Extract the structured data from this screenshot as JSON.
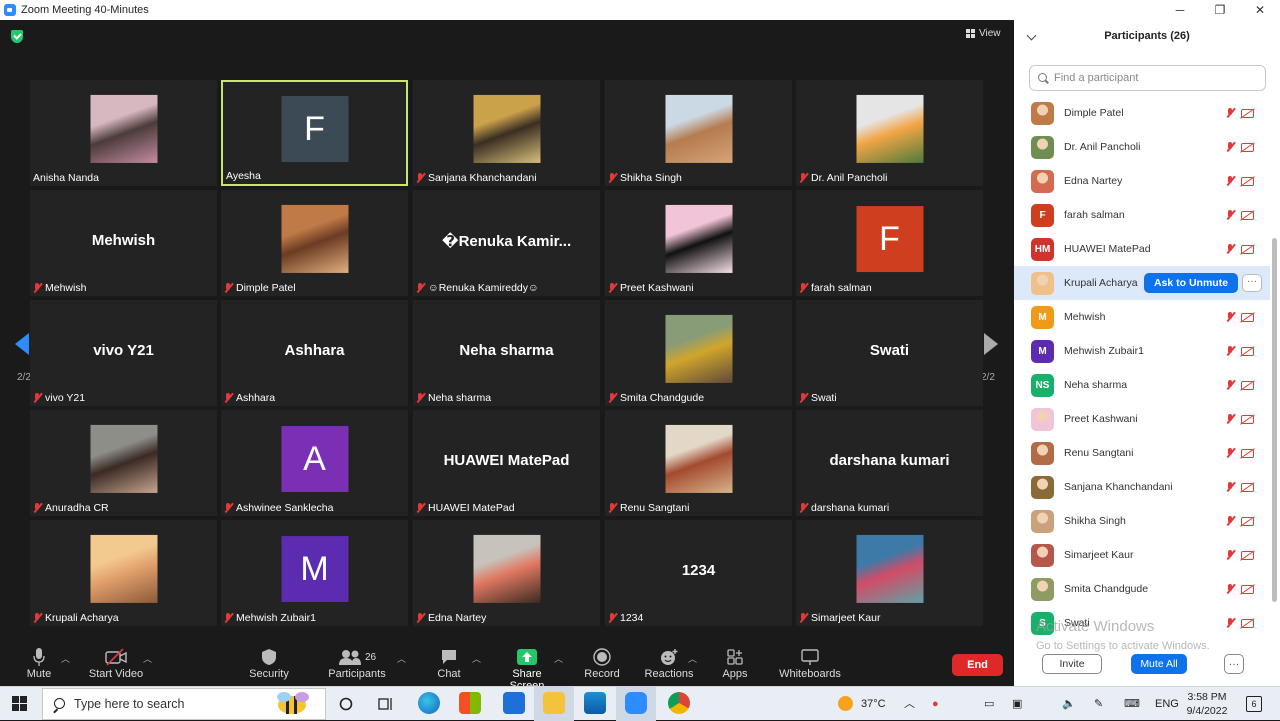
{
  "window": {
    "title": "Zoom Meeting 40-Minutes",
    "controls": [
      "─",
      "❐",
      "✕"
    ]
  },
  "view_label": "View",
  "pager": {
    "left": "2/2",
    "right": "2/2"
  },
  "tiles": [
    {
      "name": "Anisha Nanda",
      "kind": "photo",
      "colors": [
        "#d7b7c0",
        "#4b3c3a",
        "#c58ca2"
      ],
      "muted": false
    },
    {
      "name": "Ayesha",
      "kind": "letter",
      "letter": "F",
      "bg": "#3c4a55",
      "muted": false,
      "active": true
    },
    {
      "name": "Sanjana Khanchandani",
      "kind": "photo",
      "colors": [
        "#caa24a",
        "#3a2e22",
        "#d7c07a"
      ],
      "muted": true
    },
    {
      "name": "Shikha Singh",
      "kind": "photo",
      "colors": [
        "#cbd9e5",
        "#b47c4f",
        "#d6a377"
      ],
      "muted": true
    },
    {
      "name": "Dr. Anil Pancholi",
      "kind": "photo",
      "colors": [
        "#e5e5e5",
        "#f2a546",
        "#4e7a3c"
      ],
      "muted": true
    },
    {
      "name": "Mehwish",
      "kind": "text",
      "label": "Mehwish",
      "muted": true
    },
    {
      "name": "Dimple Patel",
      "kind": "photo",
      "colors": [
        "#c07a47",
        "#6b3b24",
        "#e2b07e"
      ],
      "muted": true
    },
    {
      "name": "☺Renuka Kamireddy☺",
      "kind": "text",
      "label": "�Renuka  Kamir...",
      "muted": true
    },
    {
      "name": "Preet Kashwani",
      "kind": "photo",
      "colors": [
        "#f1c4d8",
        "#111111",
        "#f8dfe9"
      ],
      "muted": true
    },
    {
      "name": "farah salman",
      "kind": "letter",
      "letter": "F",
      "bg": "#cf3e1f",
      "muted": true
    },
    {
      "name": "vivo Y21",
      "kind": "text",
      "label": "vivo Y21",
      "muted": true
    },
    {
      "name": "Ashhara",
      "kind": "text",
      "label": "Ashhara",
      "muted": true
    },
    {
      "name": "Neha sharma",
      "kind": "text",
      "label": "Neha sharma",
      "muted": true
    },
    {
      "name": "Smita Chandgude",
      "kind": "photo",
      "colors": [
        "#889c78",
        "#d1a52b",
        "#5f4a3a"
      ],
      "muted": true
    },
    {
      "name": "Swati",
      "kind": "text",
      "label": "Swati",
      "muted": true
    },
    {
      "name": "Anuradha CR",
      "kind": "photo",
      "colors": [
        "#8e8e88",
        "#3a2a24",
        "#c7a58f"
      ],
      "muted": true
    },
    {
      "name": "Ashwinee Sanklecha",
      "kind": "letter",
      "letter": "A",
      "bg": "#7b2fb5",
      "muted": true
    },
    {
      "name": "HUAWEI MatePad",
      "kind": "text",
      "label": "HUAWEI MatePad",
      "muted": true
    },
    {
      "name": "Renu Sangtani",
      "kind": "photo",
      "colors": [
        "#e3d8c8",
        "#a34a2f",
        "#d8b48b"
      ],
      "muted": true
    },
    {
      "name": "darshana kumari",
      "kind": "text",
      "label": "darshana kumari",
      "muted": true
    },
    {
      "name": "Krupali Acharya",
      "kind": "photo",
      "colors": [
        "#f2c98f",
        "#e2a06c",
        "#8c5a3a"
      ],
      "muted": true
    },
    {
      "name": "Mehwish Zubair1",
      "kind": "letter",
      "letter": "M",
      "bg": "#5b2bb0",
      "muted": true
    },
    {
      "name": "Edna Nartey",
      "kind": "photo",
      "colors": [
        "#c7c2bb",
        "#e07861",
        "#3b2a22"
      ],
      "muted": true
    },
    {
      "name": "1234",
      "kind": "text",
      "label": "1234",
      "muted": true
    },
    {
      "name": "Simarjeet Kaur",
      "kind": "photo",
      "colors": [
        "#3e7aa7",
        "#d24c66",
        "#5fa2a6"
      ],
      "muted": true
    }
  ],
  "toolbar": {
    "mute": "Mute",
    "start_video": "Start Video",
    "security": "Security",
    "participants": "Participants",
    "participants_count": "26",
    "chat": "Chat",
    "share_screen": "Share Screen",
    "record": "Record",
    "reactions": "Reactions",
    "apps": "Apps",
    "whiteboards": "Whiteboards",
    "end": "End"
  },
  "panel": {
    "title": "Participants (26)",
    "search_placeholder": "Find a participant",
    "participants": [
      {
        "name": "Dimple Patel",
        "avatar": "photo",
        "color": "#c07a47"
      },
      {
        "name": "Dr. Anil Pancholi",
        "avatar": "photo",
        "color": "#6f8f52"
      },
      {
        "name": "Edna Nartey",
        "avatar": "photo",
        "color": "#d46a4f"
      },
      {
        "name": "farah salman",
        "avatar": "F",
        "color": "#cf3e1f"
      },
      {
        "name": "HUAWEI MatePad",
        "avatar": "HM",
        "color": "#d0342c"
      },
      {
        "name": "Krupali Acharya",
        "avatar": "photo",
        "color": "#f0c08a",
        "highlight": true
      },
      {
        "name": "Mehwish",
        "avatar": "M",
        "color": "#f09a1a"
      },
      {
        "name": "Mehwish Zubair1",
        "avatar": "M",
        "color": "#5b2bb0"
      },
      {
        "name": "Neha sharma",
        "avatar": "NS",
        "color": "#18b06a"
      },
      {
        "name": "Preet Kashwani",
        "avatar": "photo",
        "color": "#f1c4d8"
      },
      {
        "name": "Renu Sangtani",
        "avatar": "photo",
        "color": "#b26b47"
      },
      {
        "name": "Sanjana Khanchandani",
        "avatar": "photo",
        "color": "#8a6a38"
      },
      {
        "name": "Shikha Singh",
        "avatar": "photo",
        "color": "#c9a27b"
      },
      {
        "name": "Simarjeet Kaur",
        "avatar": "photo",
        "color": "#b5574a"
      },
      {
        "name": "Smita Chandgude",
        "avatar": "photo",
        "color": "#8e9b62"
      },
      {
        "name": "Swati",
        "avatar": "S",
        "color": "#18b06a"
      }
    ],
    "ask_to_unmute": "Ask to Unmute",
    "more": "···",
    "invite": "Invite",
    "mute_all": "Mute All",
    "footer_more": "···"
  },
  "watermark": {
    "line1": "Activate Windows",
    "line2": "Go to Settings to activate Windows."
  },
  "taskbar": {
    "search_placeholder": "Type here to search",
    "weather": "37°C",
    "lang": "ENG",
    "time": "3:58 PM",
    "date": "9/4/2022",
    "notif_count": "6"
  }
}
